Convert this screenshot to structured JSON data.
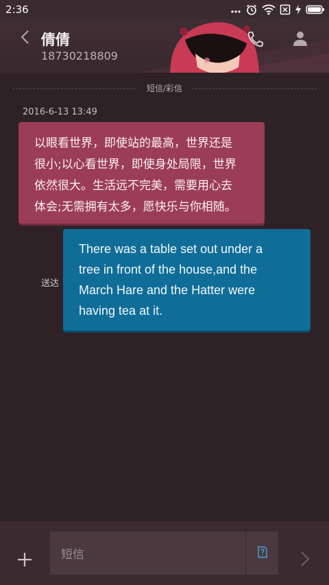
{
  "status_bar": {
    "time": "2:36",
    "icons": [
      "more-dots-icon",
      "alarm-icon",
      "wifi-icon",
      "no-sim-icon",
      "charging-icon",
      "battery-icon"
    ]
  },
  "header": {
    "contact_name": "倩倩",
    "contact_number": "18730218809",
    "icons": [
      "chevron-left-icon",
      "phone-icon",
      "person-icon"
    ]
  },
  "conversation": {
    "type_divider": "短信/彩信",
    "timestamp": "2016-6-13 13:49",
    "incoming_message": {
      "lines": [
        "以眼看世界，即使站的最高，世界还是",
        "很小;以心看世界，即使身处局限，世界",
        "依然很大。生活远不完美，需要用心去",
        "体会;无需拥有太多，愿快乐与你相随。"
      ]
    },
    "sent_status": "送达",
    "outgoing_message": {
      "lines": [
        "There was a table set out under a",
        "tree in front of the house,and the",
        "March Hare and the Hatter were",
        "having tea at it."
      ]
    }
  },
  "input_bar": {
    "placeholder": "短信",
    "icons": [
      "plus-icon",
      "sim-card-icon",
      "send-chevron-icon"
    ]
  },
  "colors": {
    "background": "#2e2227",
    "header": "#3f2e34",
    "incoming_bubble": "#9b3d56",
    "outgoing_bubble": "#0f6d98",
    "input_field": "#4a3a40"
  }
}
